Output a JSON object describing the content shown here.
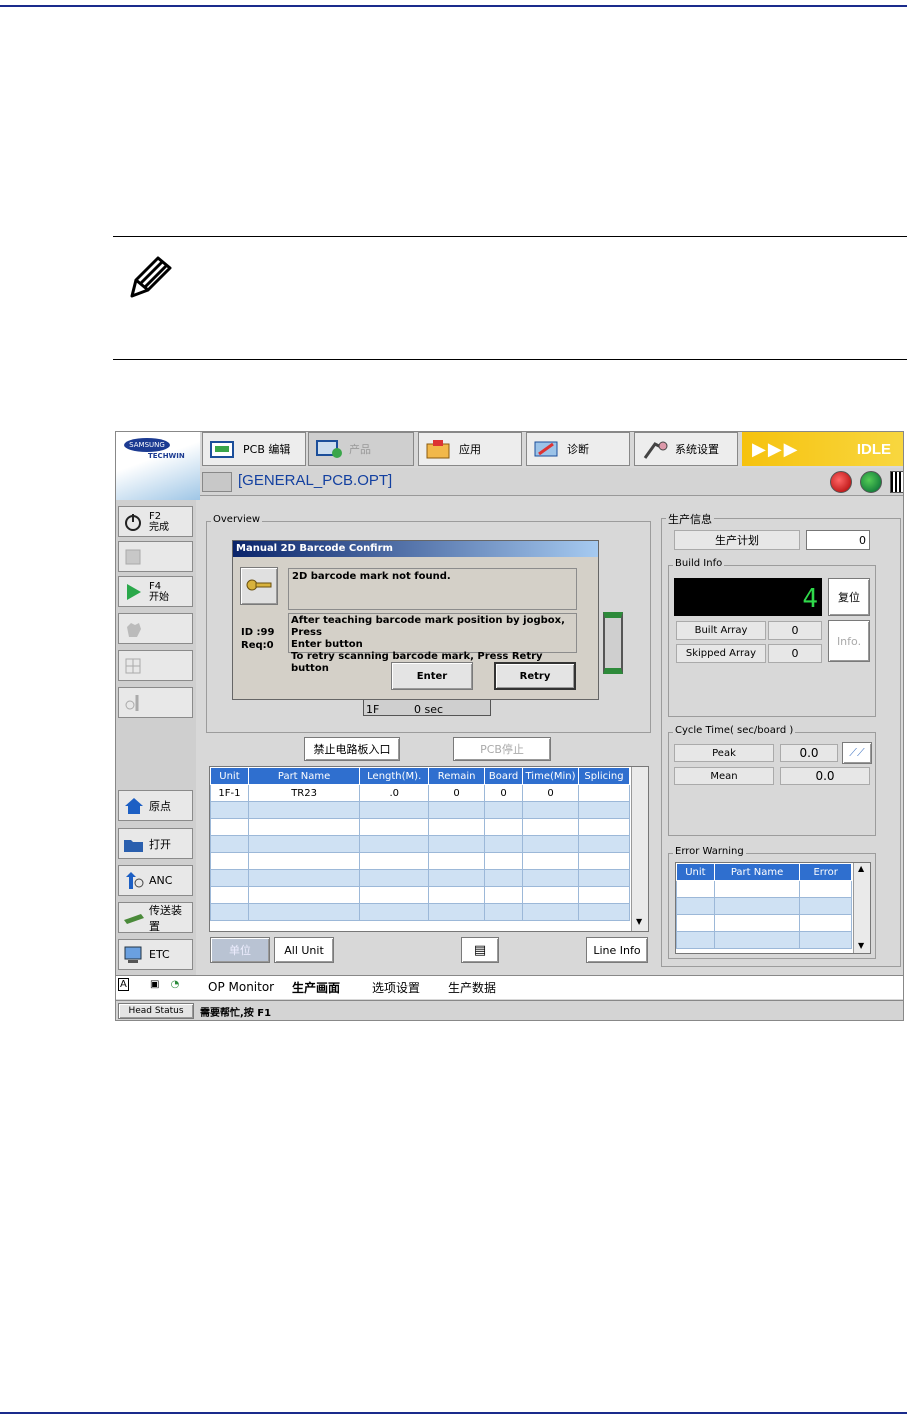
{
  "app": {
    "logo_top": "SAMSUNG",
    "logo_bottom": "TECHWIN",
    "top_tabs": [
      "PCB 编辑",
      "产品",
      "应用",
      "诊断",
      "系统设置"
    ],
    "status": "IDLE",
    "file_title": "[GENERAL_PCB.OPT]",
    "side_buttons": {
      "f2_key": "F2",
      "f2_label": "完成",
      "f4_key": "F4",
      "f4_label": "开始",
      "home": "原点",
      "open": "打开",
      "anc": "ANC",
      "conveyor": "传送装置",
      "etc": "ETC"
    },
    "overview": {
      "label": "Overview",
      "head_1f": "1F",
      "head_time": "0 sec",
      "btn_stop_entry": "禁止电路板入口",
      "btn_pcb_stop": "PCB停止"
    },
    "dialog": {
      "title": "Manual 2D Barcode Confirm",
      "message": "2D barcode mark not found.",
      "id_label": "ID  :99",
      "req_label": "Req:0",
      "instr_1": "After teaching barcode mark position by jogbox, Press",
      "instr_2": "Enter button",
      "instr_3": "To retry scanning barcode mark, Press Retry button",
      "enter": "Enter",
      "retry": "Retry"
    },
    "feeder_table": {
      "columns": [
        "Unit",
        "Part Name",
        "Length(M).",
        "Remain",
        "Board",
        "Time(Min)",
        "Splicing"
      ],
      "rows": [
        [
          "1F-1",
          "TR23",
          ".0",
          "0",
          "0",
          "0",
          ""
        ]
      ]
    },
    "bottom_buttons": {
      "unit": "单位",
      "all_unit": "All Unit",
      "line_info": "Line Info"
    },
    "prod_info": {
      "label": "生产信息",
      "plan_label": "生产计划",
      "plan_value": "0",
      "build_info": "Build Info",
      "build_count": "4",
      "reset": "复位",
      "built_array_label": "Built Array",
      "built_array_value": "0",
      "skipped_array_label": "Skipped Array",
      "skipped_array_value": "0",
      "info_btn": "Info."
    },
    "cycle": {
      "label": "Cycle Time( sec/board )",
      "peak_label": "Peak",
      "peak_value": "0.0",
      "mean_label": "Mean",
      "mean_value": "0.0"
    },
    "error": {
      "label": "Error Warning",
      "columns": [
        "Unit",
        "Part Name",
        "Error"
      ]
    },
    "bottom_tabs": [
      "OP Monitor",
      "生产画面",
      "选项设置",
      "生产数据"
    ],
    "status_bar": {
      "head_status": "Head Status",
      "message": "需要帮忙,按 F1"
    }
  }
}
